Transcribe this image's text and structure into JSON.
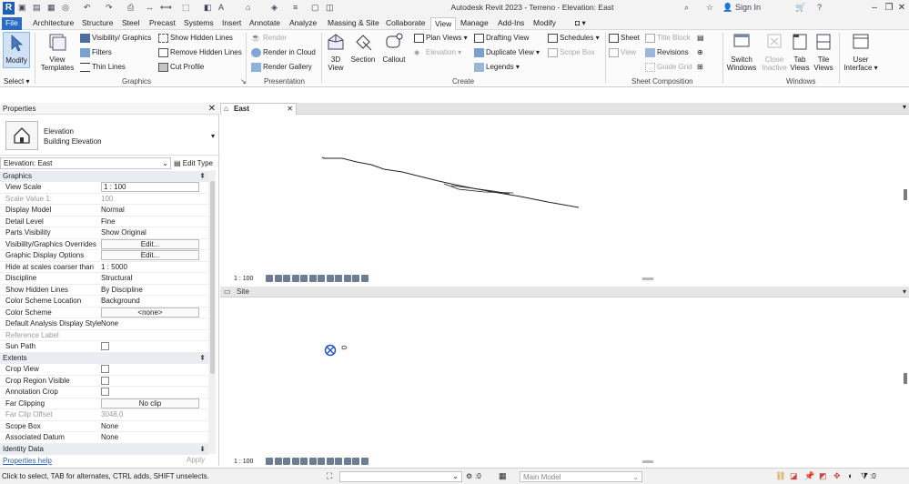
{
  "title_bar": {
    "window_title": "Autodesk Revit 2023 - Terreno - Elevation: East",
    "app_icon_letter": "R",
    "sign_in": "Sign In",
    "help_glyph": "?"
  },
  "tabs": [
    "File",
    "Architecture",
    "Structure",
    "Steel",
    "Precast",
    "Systems",
    "Insert",
    "Annotate",
    "Analyze",
    "Massing & Site",
    "Collaborate",
    "View",
    "Manage",
    "Add-Ins",
    "Modify"
  ],
  "active_tab": "View",
  "ribbon": {
    "select": {
      "modify": "Modify",
      "select_label": "Select"
    },
    "graphics": {
      "view_templates": "View Templates",
      "visibility_graphics": "Visibility/ Graphics",
      "filters": "Filters",
      "thin_lines": "Thin Lines",
      "show_hidden_lines": "Show Hidden Lines",
      "remove_hidden_lines": "Remove Hidden Lines",
      "cut_profile": "Cut Profile",
      "panel": "Graphics"
    },
    "presentation": {
      "render": "Render",
      "render_in_cloud": "Render in Cloud",
      "render_gallery": "Render Gallery",
      "panel": "Presentation"
    },
    "create": {
      "view_3d": "3D View",
      "section": "Section",
      "callout": "Callout",
      "plan_views": "Plan Views",
      "elevation": "Elevation",
      "drafting_view": "Drafting View",
      "duplicate_view": "Duplicate View",
      "legends": "Legends",
      "schedules": "Schedules",
      "scope_box": "Scope Box",
      "panel": "Create"
    },
    "sheet_composition": {
      "sheet": "Sheet",
      "title_block": "Title Block",
      "view": "View",
      "revisions": "Revisions",
      "guide_grid": "Guide Grid",
      "panel": "Sheet Composition"
    },
    "windows": {
      "switch_windows": "Switch Windows",
      "close_inactive": "Close Inactive",
      "tab_views": "Tab Views",
      "tile_views": "Tile Views",
      "user_interface": "User Interface",
      "panel": "Windows"
    }
  },
  "properties": {
    "header": "Properties",
    "type_name": "Elevation",
    "type_sub": "Building Elevation",
    "instance_filter": "Elevation: East",
    "edit_type": "Edit Type",
    "groups": {
      "graphics": "Graphics",
      "extents": "Extents",
      "identity_data": "Identity Data"
    },
    "graphics_rows": [
      {
        "key": "View Scale",
        "value": "1 : 100",
        "kind": "box",
        "dim": false
      },
      {
        "key": "Scale Value   1:",
        "value": "100",
        "kind": "text",
        "dim": true
      },
      {
        "key": "Display Model",
        "value": "Normal",
        "kind": "text",
        "dim": false
      },
      {
        "key": "Detail Level",
        "value": "Fine",
        "kind": "text",
        "dim": false
      },
      {
        "key": "Parts Visibility",
        "value": "Show Original",
        "kind": "text",
        "dim": false
      },
      {
        "key": "Visibility/Graphics Overrides",
        "value": "Edit...",
        "kind": "btn",
        "dim": false
      },
      {
        "key": "Graphic Display Options",
        "value": "Edit...",
        "kind": "btn",
        "dim": false
      },
      {
        "key": "Hide at scales coarser than",
        "value": "1 : 5000",
        "kind": "text",
        "dim": false
      },
      {
        "key": "Discipline",
        "value": "Structural",
        "kind": "text",
        "dim": false
      },
      {
        "key": "Show Hidden Lines",
        "value": "By Discipline",
        "kind": "text",
        "dim": false
      },
      {
        "key": "Color Scheme Location",
        "value": "Background",
        "kind": "text",
        "dim": false
      },
      {
        "key": "Color Scheme",
        "value": "<none>",
        "kind": "btn",
        "dim": false
      },
      {
        "key": "Default Analysis Display Style",
        "value": "None",
        "kind": "text",
        "dim": false
      },
      {
        "key": "Reference Label",
        "value": "",
        "kind": "text",
        "dim": true
      },
      {
        "key": "Sun Path",
        "value": "",
        "kind": "chk",
        "dim": false
      }
    ],
    "extents_rows": [
      {
        "key": "Crop View",
        "value": "",
        "kind": "chk",
        "dim": false
      },
      {
        "key": "Crop Region Visible",
        "value": "",
        "kind": "chk",
        "dim": false
      },
      {
        "key": "Annotation Crop",
        "value": "",
        "kind": "chk",
        "dim": false
      },
      {
        "key": "Far Clipping",
        "value": "No clip",
        "kind": "btn",
        "dim": false
      },
      {
        "key": "Far Clip Offset",
        "value": "3048.0",
        "kind": "text",
        "dim": true
      },
      {
        "key": "Scope Box",
        "value": "None",
        "kind": "text",
        "dim": false
      },
      {
        "key": "Associated Datum",
        "value": "None",
        "kind": "text",
        "dim": false
      }
    ],
    "help_link": "Properties help",
    "apply": "Apply"
  },
  "views": {
    "east": {
      "tab_label": "East",
      "scale": "1 : 100"
    },
    "site": {
      "title": "Site",
      "scale": "1 : 100"
    }
  },
  "status_bar": {
    "message": "Click to select, TAB for alternates, CTRL adds, SHIFT unselects.",
    "coord": ":0",
    "model": "Main Model",
    "filter_count": ":0"
  },
  "colors": {
    "file_tab": "#2a6cc4",
    "accent_blue": "#1e5fb4",
    "group_header": "#e9edf2"
  }
}
